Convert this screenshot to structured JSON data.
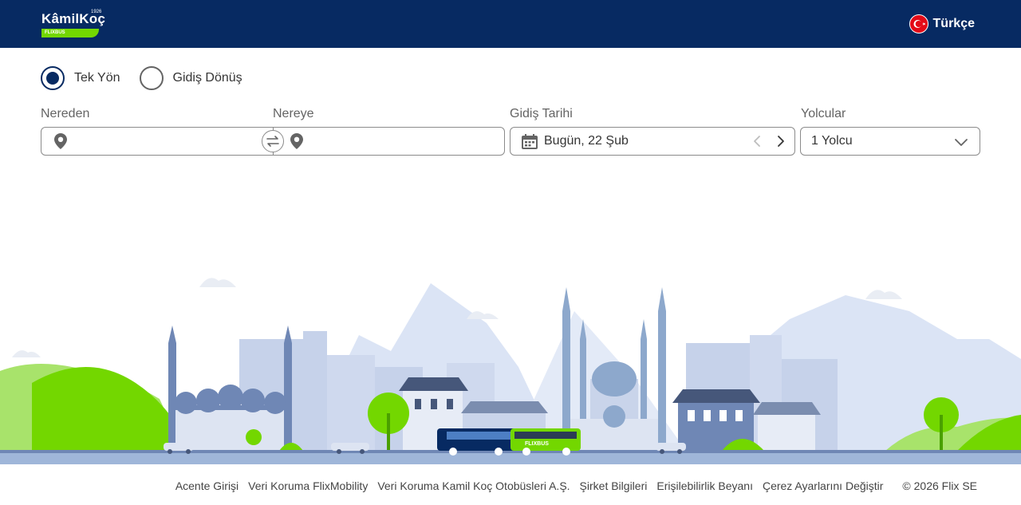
{
  "header": {
    "logo": {
      "brand": "KâmilKoç",
      "year": "1926",
      "sub": "FLIXBUS"
    },
    "language": {
      "label": "Türkçe",
      "icon": "turkey-flag-icon"
    }
  },
  "trip_type": {
    "options": [
      {
        "label": "Tek Yön",
        "checked": true
      },
      {
        "label": "Gidiş Dönüş",
        "checked": false
      }
    ]
  },
  "search": {
    "from": {
      "label": "Nereden",
      "value": "",
      "icon": "map-pin-icon"
    },
    "to": {
      "label": "Nereye",
      "value": "",
      "icon": "map-pin-icon"
    },
    "swap_icon": "swap-arrows-icon",
    "date": {
      "label": "Gidiş Tarihi",
      "value": "Bugün, 22 Şub",
      "icon": "calendar-icon"
    },
    "passengers": {
      "label": "Yolcular",
      "value": "1 Yolcu",
      "icon": "chevron-down-icon"
    }
  },
  "scene": {
    "bus_label": "FLIXBUS"
  },
  "footer": {
    "links": [
      "Acente Girişi",
      "Veri Koruma FlixMobility",
      "Veri Koruma Kamil Koç Otobüsleri A.Ş.",
      "Şirket Bilgileri",
      "Erişilebilirlik Beyanı",
      "Çerez Ayarlarını Değiştir"
    ],
    "copyright": "© 2026 Flix SE"
  },
  "colors": {
    "header_bg": "#072a62",
    "accent_green": "#73d700",
    "text": "#353535",
    "border": "#8b8b8b"
  }
}
